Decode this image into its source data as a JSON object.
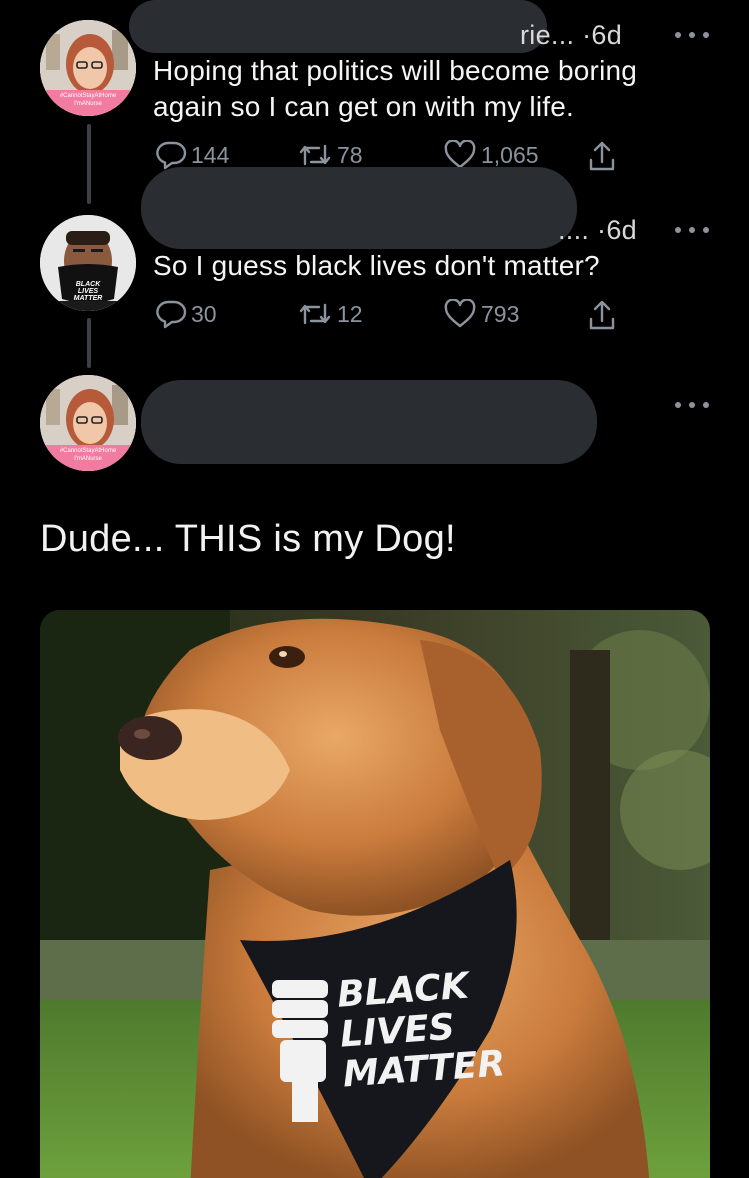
{
  "thread": [
    {
      "author_suffix": "rie...",
      "separator": "·",
      "time": "6d",
      "text": "Hoping that politics will become boring again so I can get on with my life.",
      "stats": {
        "replies": "144",
        "retweets": "78",
        "likes": "1,065"
      },
      "avatar_banner": [
        "#CannotStayAtHome",
        "I'mANurse"
      ]
    },
    {
      "author_suffix": "....",
      "separator": "·",
      "time": "6d",
      "text": "So I guess black lives don't matter?",
      "stats": {
        "replies": "30",
        "retweets": "12",
        "likes": "793"
      },
      "avatar_mask_text": [
        "BLACK",
        "LIVES",
        "MATTER"
      ]
    }
  ],
  "reply": {
    "text": "Dude... THIS is my Dog!",
    "avatar_banner": [
      "#CannotStayAtHome",
      "I'mANurse"
    ],
    "image": {
      "description_icon": "dog-photo",
      "bandana_text": [
        "BLACK",
        "LIVES",
        "MATTER"
      ]
    }
  },
  "icons": {
    "reply": "reply-icon",
    "retweet": "retweet-icon",
    "like": "heart-icon",
    "share": "share-icon",
    "more": "more-icon"
  },
  "colors": {
    "background": "#000000",
    "text": "#f5f5f5",
    "muted": "#8b949e",
    "redaction": "#2a2e33",
    "thread_line": "#3d4147",
    "avatar_accent": "#f27ba0"
  }
}
